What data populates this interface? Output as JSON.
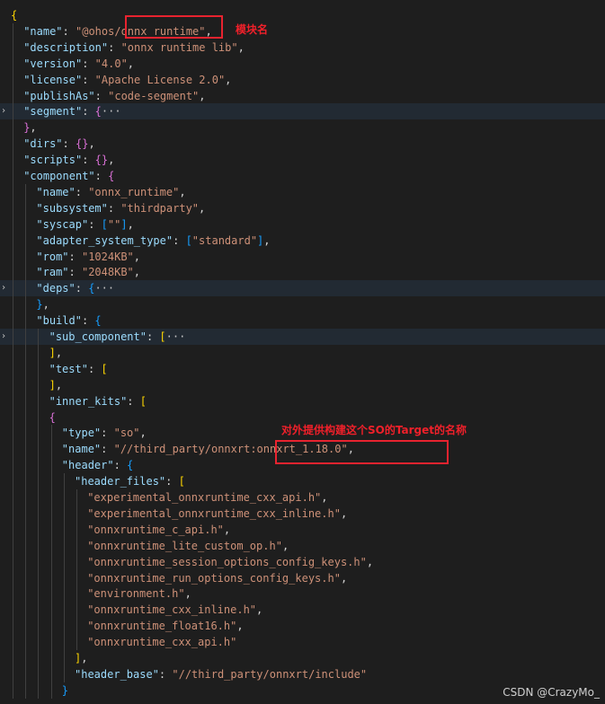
{
  "editor": {
    "lines": [
      {
        "indent": 0,
        "segments": [
          {
            "c": "b1",
            "t": "{"
          }
        ]
      },
      {
        "indent": 1,
        "segments": [
          {
            "c": "k",
            "t": "\"name\""
          },
          {
            "c": "p",
            "t": ": "
          },
          {
            "c": "s",
            "t": "\"@ohos/onnx_runtime\""
          },
          {
            "c": "p",
            "t": ","
          }
        ]
      },
      {
        "indent": 1,
        "segments": [
          {
            "c": "k",
            "t": "\"description\""
          },
          {
            "c": "p",
            "t": ": "
          },
          {
            "c": "s",
            "t": "\"onnx runtime lib\""
          },
          {
            "c": "p",
            "t": ","
          }
        ]
      },
      {
        "indent": 1,
        "segments": [
          {
            "c": "k",
            "t": "\"version\""
          },
          {
            "c": "p",
            "t": ": "
          },
          {
            "c": "s",
            "t": "\"4.0\""
          },
          {
            "c": "p",
            "t": ","
          }
        ]
      },
      {
        "indent": 1,
        "segments": [
          {
            "c": "k",
            "t": "\"license\""
          },
          {
            "c": "p",
            "t": ": "
          },
          {
            "c": "s",
            "t": "\"Apache License 2.0\""
          },
          {
            "c": "p",
            "t": ","
          }
        ]
      },
      {
        "indent": 1,
        "segments": [
          {
            "c": "k",
            "t": "\"publishAs\""
          },
          {
            "c": "p",
            "t": ": "
          },
          {
            "c": "s",
            "t": "\"code-segment\""
          },
          {
            "c": "p",
            "t": ","
          }
        ]
      },
      {
        "indent": 1,
        "folded": true,
        "segments": [
          {
            "c": "k",
            "t": "\"segment\""
          },
          {
            "c": "p",
            "t": ": "
          },
          {
            "c": "b2",
            "t": "{"
          },
          {
            "c": "ell",
            "t": "···"
          }
        ]
      },
      {
        "indent": 1,
        "segments": [
          {
            "c": "b2",
            "t": "}"
          },
          {
            "c": "p",
            "t": ","
          }
        ]
      },
      {
        "indent": 1,
        "segments": [
          {
            "c": "k",
            "t": "\"dirs\""
          },
          {
            "c": "p",
            "t": ": "
          },
          {
            "c": "b2",
            "t": "{}"
          },
          {
            "c": "p",
            "t": ","
          }
        ]
      },
      {
        "indent": 1,
        "segments": [
          {
            "c": "k",
            "t": "\"scripts\""
          },
          {
            "c": "p",
            "t": ": "
          },
          {
            "c": "b2",
            "t": "{}"
          },
          {
            "c": "p",
            "t": ","
          }
        ]
      },
      {
        "indent": 1,
        "segments": [
          {
            "c": "k",
            "t": "\"component\""
          },
          {
            "c": "p",
            "t": ": "
          },
          {
            "c": "b2",
            "t": "{"
          }
        ]
      },
      {
        "indent": 2,
        "segments": [
          {
            "c": "k",
            "t": "\"name\""
          },
          {
            "c": "p",
            "t": ": "
          },
          {
            "c": "s",
            "t": "\"onnx_runtime\""
          },
          {
            "c": "p",
            "t": ","
          }
        ]
      },
      {
        "indent": 2,
        "segments": [
          {
            "c": "k",
            "t": "\"subsystem\""
          },
          {
            "c": "p",
            "t": ": "
          },
          {
            "c": "s",
            "t": "\"thirdparty\""
          },
          {
            "c": "p",
            "t": ","
          }
        ]
      },
      {
        "indent": 2,
        "segments": [
          {
            "c": "k",
            "t": "\"syscap\""
          },
          {
            "c": "p",
            "t": ": "
          },
          {
            "c": "b3",
            "t": "["
          },
          {
            "c": "s",
            "t": "\"\""
          },
          {
            "c": "b3",
            "t": "]"
          },
          {
            "c": "p",
            "t": ","
          }
        ]
      },
      {
        "indent": 2,
        "segments": [
          {
            "c": "k",
            "t": "\"adapter_system_type\""
          },
          {
            "c": "p",
            "t": ": "
          },
          {
            "c": "b3",
            "t": "["
          },
          {
            "c": "s",
            "t": "\"standard\""
          },
          {
            "c": "b3",
            "t": "]"
          },
          {
            "c": "p",
            "t": ","
          }
        ]
      },
      {
        "indent": 2,
        "segments": [
          {
            "c": "k",
            "t": "\"rom\""
          },
          {
            "c": "p",
            "t": ": "
          },
          {
            "c": "s",
            "t": "\"1024KB\""
          },
          {
            "c": "p",
            "t": ","
          }
        ]
      },
      {
        "indent": 2,
        "segments": [
          {
            "c": "k",
            "t": "\"ram\""
          },
          {
            "c": "p",
            "t": ": "
          },
          {
            "c": "s",
            "t": "\"2048KB\""
          },
          {
            "c": "p",
            "t": ","
          }
        ]
      },
      {
        "indent": 2,
        "folded": true,
        "segments": [
          {
            "c": "k",
            "t": "\"deps\""
          },
          {
            "c": "p",
            "t": ": "
          },
          {
            "c": "b3",
            "t": "{"
          },
          {
            "c": "ell",
            "t": "···"
          }
        ]
      },
      {
        "indent": 2,
        "segments": [
          {
            "c": "b3",
            "t": "}"
          },
          {
            "c": "p",
            "t": ","
          }
        ]
      },
      {
        "indent": 2,
        "segments": [
          {
            "c": "k",
            "t": "\"build\""
          },
          {
            "c": "p",
            "t": ": "
          },
          {
            "c": "b3",
            "t": "{"
          }
        ]
      },
      {
        "indent": 3,
        "folded": true,
        "segments": [
          {
            "c": "k",
            "t": "\"sub_component\""
          },
          {
            "c": "p",
            "t": ": "
          },
          {
            "c": "b1",
            "t": "["
          },
          {
            "c": "ell",
            "t": "···"
          }
        ]
      },
      {
        "indent": 3,
        "segments": [
          {
            "c": "b1",
            "t": "]"
          },
          {
            "c": "p",
            "t": ","
          }
        ]
      },
      {
        "indent": 3,
        "segments": [
          {
            "c": "k",
            "t": "\"test\""
          },
          {
            "c": "p",
            "t": ": "
          },
          {
            "c": "b1",
            "t": "["
          }
        ]
      },
      {
        "indent": 3,
        "segments": [
          {
            "c": "b1",
            "t": "]"
          },
          {
            "c": "p",
            "t": ","
          }
        ]
      },
      {
        "indent": 3,
        "segments": [
          {
            "c": "k",
            "t": "\"inner_kits\""
          },
          {
            "c": "p",
            "t": ": "
          },
          {
            "c": "b1",
            "t": "["
          }
        ]
      },
      {
        "indent": 3,
        "segments": [
          {
            "c": "b2",
            "t": "{"
          }
        ]
      },
      {
        "indent": 4,
        "segments": [
          {
            "c": "k",
            "t": "\"type\""
          },
          {
            "c": "p",
            "t": ": "
          },
          {
            "c": "s",
            "t": "\"so\""
          },
          {
            "c": "p",
            "t": ","
          }
        ]
      },
      {
        "indent": 4,
        "segments": [
          {
            "c": "k",
            "t": "\"name\""
          },
          {
            "c": "p",
            "t": ": "
          },
          {
            "c": "s",
            "t": "\"//third_party/onnxrt:onnxrt_1.18.0\""
          },
          {
            "c": "p",
            "t": ","
          }
        ]
      },
      {
        "indent": 4,
        "segments": [
          {
            "c": "k",
            "t": "\"header\""
          },
          {
            "c": "p",
            "t": ": "
          },
          {
            "c": "b3",
            "t": "{"
          }
        ]
      },
      {
        "indent": 5,
        "segments": [
          {
            "c": "k",
            "t": "\"header_files\""
          },
          {
            "c": "p",
            "t": ": "
          },
          {
            "c": "b1",
            "t": "["
          }
        ]
      },
      {
        "indent": 6,
        "segments": [
          {
            "c": "s",
            "t": "\"experimental_onnxruntime_cxx_api.h\""
          },
          {
            "c": "p",
            "t": ","
          }
        ]
      },
      {
        "indent": 6,
        "segments": [
          {
            "c": "s",
            "t": "\"experimental_onnxruntime_cxx_inline.h\""
          },
          {
            "c": "p",
            "t": ","
          }
        ]
      },
      {
        "indent": 6,
        "segments": [
          {
            "c": "s",
            "t": "\"onnxruntime_c_api.h\""
          },
          {
            "c": "p",
            "t": ","
          }
        ]
      },
      {
        "indent": 6,
        "segments": [
          {
            "c": "s",
            "t": "\"onnxruntime_lite_custom_op.h\""
          },
          {
            "c": "p",
            "t": ","
          }
        ]
      },
      {
        "indent": 6,
        "segments": [
          {
            "c": "s",
            "t": "\"onnxruntime_session_options_config_keys.h\""
          },
          {
            "c": "p",
            "t": ","
          }
        ]
      },
      {
        "indent": 6,
        "segments": [
          {
            "c": "s",
            "t": "\"onnxruntime_run_options_config_keys.h\""
          },
          {
            "c": "p",
            "t": ","
          }
        ]
      },
      {
        "indent": 6,
        "segments": [
          {
            "c": "s",
            "t": "\"environment.h\""
          },
          {
            "c": "p",
            "t": ","
          }
        ]
      },
      {
        "indent": 6,
        "segments": [
          {
            "c": "s",
            "t": "\"onnxruntime_cxx_inline.h\""
          },
          {
            "c": "p",
            "t": ","
          }
        ]
      },
      {
        "indent": 6,
        "segments": [
          {
            "c": "s",
            "t": "\"onnxruntime_float16.h\""
          },
          {
            "c": "p",
            "t": ","
          }
        ]
      },
      {
        "indent": 6,
        "segments": [
          {
            "c": "s",
            "t": "\"onnxruntime_cxx_api.h\""
          }
        ]
      },
      {
        "indent": 5,
        "segments": [
          {
            "c": "b1",
            "t": "]"
          },
          {
            "c": "p",
            "t": ","
          }
        ]
      },
      {
        "indent": 5,
        "segments": [
          {
            "c": "k",
            "t": "\"header_base\""
          },
          {
            "c": "p",
            "t": ": "
          },
          {
            "c": "s",
            "t": "\"//third_party/onnxrt/include\""
          }
        ]
      },
      {
        "indent": 4,
        "segments": [
          {
            "c": "b3",
            "t": "}"
          }
        ]
      }
    ]
  },
  "annotations": {
    "module_name_label": "模块名",
    "target_name_label": "对外提供构建这个SO的Target的名称",
    "color": "#e8232f"
  },
  "watermark": "CSDN @CrazyMo_"
}
